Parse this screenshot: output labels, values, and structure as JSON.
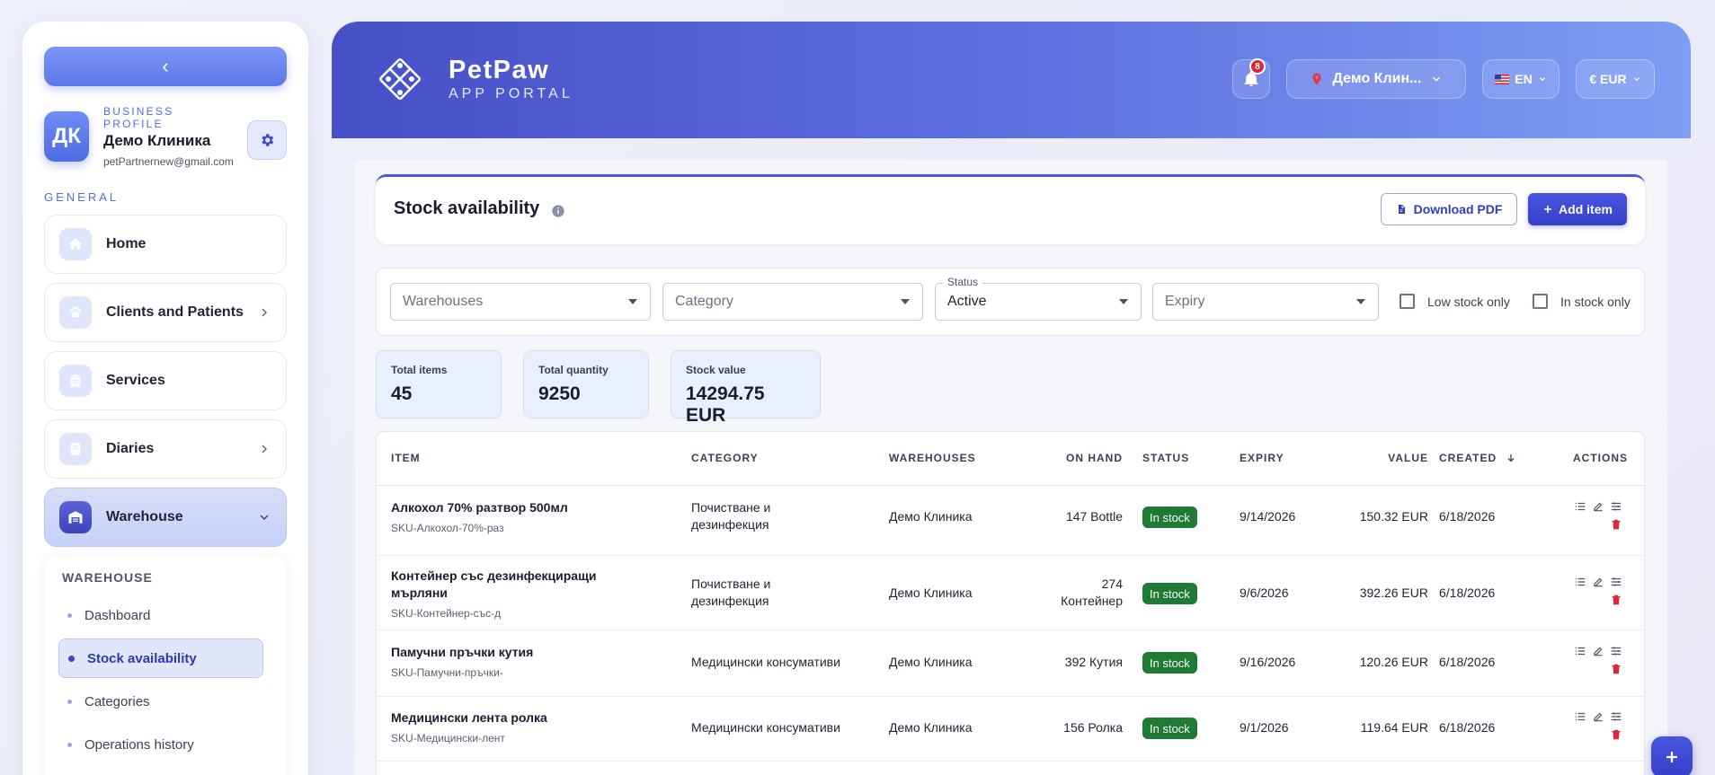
{
  "sidebar": {
    "collapse_glyph": "‹",
    "profile": {
      "initials": "ДК",
      "label": "BUSINESS PROFILE",
      "name": "Демо Клиника",
      "email": "petPartnernew@gmail.com"
    },
    "section_label": "GENERAL",
    "items": [
      {
        "label": "Home",
        "icon": "home-icon"
      },
      {
        "label": "Clients and Patients",
        "icon": "paw-icon"
      },
      {
        "label": "Services",
        "icon": "clipboard-icon"
      },
      {
        "label": "Diaries",
        "icon": "book-icon"
      },
      {
        "label": "Warehouse",
        "icon": "warehouse-icon"
      }
    ],
    "submenu": {
      "title": "WAREHOUSE",
      "items": [
        "Dashboard",
        "Stock availability",
        "Categories",
        "Operations history"
      ],
      "active": "Stock availability"
    }
  },
  "header": {
    "brand_name": "PetPaw",
    "brand_sub": "APP PORTAL",
    "notification_count": "8",
    "clinic_selector": "Демо Клин...",
    "language": "EN",
    "currency": "€ EUR"
  },
  "page": {
    "title": "Stock availability",
    "download_pdf_label": "Download PDF",
    "add_item_label": "Add item"
  },
  "filters": {
    "warehouses_placeholder": "Warehouses",
    "category_placeholder": "Category",
    "status_label": "Status",
    "status_value": "Active",
    "expiry_placeholder": "Expiry",
    "low_stock_label": "Low stock only",
    "in_stock_label": "In stock only"
  },
  "stats": [
    {
      "label": "Total items",
      "value": "45"
    },
    {
      "label": "Total quantity",
      "value": "9250"
    },
    {
      "label": "Stock value",
      "value": "14294.75 EUR"
    }
  ],
  "table": {
    "columns": [
      "ITEM",
      "CATEGORY",
      "WAREHOUSES",
      "ON HAND",
      "STATUS",
      "EXPIRY",
      "VALUE",
      "CREATED",
      "ACTIONS"
    ],
    "rows": [
      {
        "name": "Алкохол 70% разтвор 500мл",
        "sku": "SKU-Алкохол-70%-раз",
        "category": "Почистване и дезинфекция",
        "warehouse": "Демо Клиника",
        "on_hand": "147 Bottle",
        "status": "In stock",
        "expiry": "9/14/2026",
        "value": "150.32 EUR",
        "created": "6/18/2026"
      },
      {
        "name": "Контейнер със дезинфекциращи мърляни",
        "sku": "SKU-Контейнер-със-д",
        "category": "Почистване и дезинфекция",
        "warehouse": "Демо Клиника",
        "on_hand": "274 Контейнер",
        "status": "In stock",
        "expiry": "9/6/2026",
        "value": "392.26 EUR",
        "created": "6/18/2026"
      },
      {
        "name": "Памучни пръчки кутия",
        "sku": "SKU-Памучни-пръчки-",
        "category": "Медицински консумативи",
        "warehouse": "Демо Клиника",
        "on_hand": "392 Кутия",
        "status": "In stock",
        "expiry": "9/16/2026",
        "value": "120.26 EUR",
        "created": "6/18/2026"
      },
      {
        "name": "Медицински лента ролка",
        "sku": "SKU-Медицински-лент",
        "category": "Медицински консумативи",
        "warehouse": "Демо Клиника",
        "on_hand": "156 Ролка",
        "status": "In stock",
        "expiry": "9/1/2026",
        "value": "119.64 EUR",
        "created": "6/18/2026"
      }
    ]
  },
  "colors": {
    "accent": "#4a55e0",
    "in_stock": "#1f7a34",
    "danger": "#d9283c"
  }
}
